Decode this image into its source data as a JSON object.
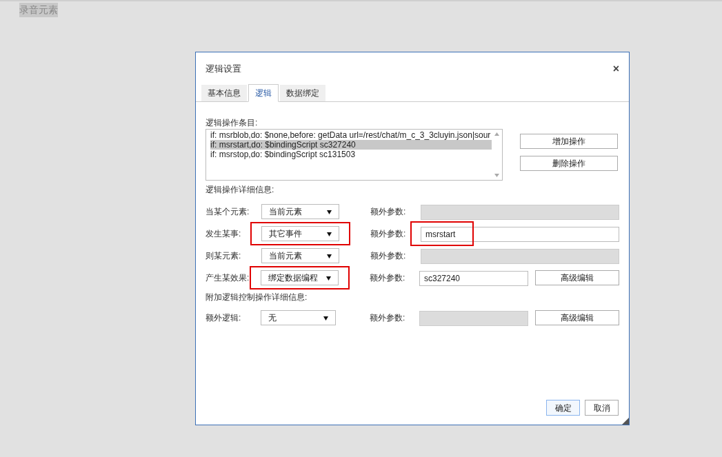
{
  "page": {
    "title": "录音元素"
  },
  "dialog": {
    "title": "逻辑设置",
    "close": "×",
    "tabs": [
      {
        "label": "基本信息",
        "selected": false
      },
      {
        "label": "逻辑",
        "selected": true
      },
      {
        "label": "数据绑定",
        "selected": false
      }
    ],
    "list_label": "逻辑操作条目:",
    "list_items": [
      {
        "text": "if: msrblob,do: $none,before: getData url=/rest/chat/m_c_3_3cluyin.json|sour",
        "selected": false
      },
      {
        "text": "if: msrstart,do: $bindingScript sc327240",
        "selected": true
      },
      {
        "text": "if: msrstop,do: $bindingScript sc131503",
        "selected": false
      }
    ],
    "list_buttons": [
      "增加操作",
      "删除操作"
    ],
    "detail_label": "逻辑操作详细信息:",
    "rows": [
      {
        "label": "当某个元素:",
        "select": "当前元素",
        "select_highlighted": false,
        "extra_label": "额外参数:",
        "extra_value": "",
        "extra_disabled": true,
        "extra_highlighted": false
      },
      {
        "label": "发生某事:",
        "select": "其它事件",
        "select_highlighted": true,
        "extra_label": "额外参数:",
        "extra_value": "msrstart",
        "extra_disabled": false,
        "extra_highlighted": true
      },
      {
        "label": "则某元素:",
        "select": "当前元素",
        "select_highlighted": false,
        "extra_label": "额外参数:",
        "extra_value": "",
        "extra_disabled": true,
        "extra_highlighted": false
      },
      {
        "label": "产生某效果:",
        "select": "绑定数据编程",
        "select_highlighted": true,
        "extra_label": "额外参数:",
        "extra_value": "sc327240",
        "extra_disabled": false,
        "extra_highlighted": false,
        "button": "高级编辑"
      }
    ],
    "additional_label": "附加逻辑控制操作详细信息:",
    "additional_rows": [
      {
        "label": "额外逻辑:",
        "select": "无",
        "select_highlighted": false,
        "extra_label": "额外参数:",
        "extra_value": "",
        "extra_disabled": true,
        "extra_highlighted": false,
        "button": "高级编辑"
      }
    ],
    "footer_buttons": [
      {
        "label": "确定",
        "kind": "primary"
      },
      {
        "label": "取消",
        "kind": "normal"
      }
    ]
  }
}
